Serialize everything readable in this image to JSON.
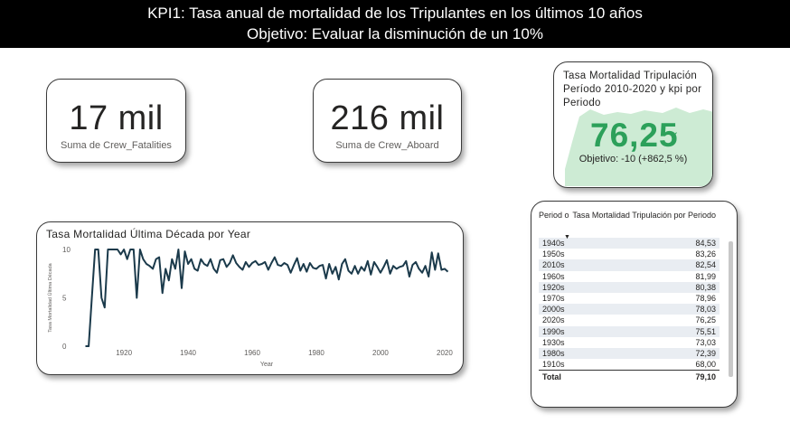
{
  "header": {
    "line1": "KPI1: Tasa anual de mortalidad de los Tripulantes en los últimos 10 años",
    "line2": "Objetivo: Evaluar la disminución de un 10%"
  },
  "card_fatalities": {
    "value": "17 mil",
    "label": "Suma de Crew_Fatalities"
  },
  "card_aboard": {
    "value": "216 mil",
    "label": "Suma de Crew_Aboard"
  },
  "kpi_card": {
    "title": "Tasa Mortalidad Tripulación Período 2010-2020 y kpi por Periodo",
    "value": "76,25",
    "check_icon": "checkmark-icon",
    "goal": "Objetivo: -10 (+862,5 %)",
    "accent": "#2ca05a",
    "area_color": "#cdebd4"
  },
  "table": {
    "col1": "Period o",
    "col2": "Tasa Mortalidad Tripulación por Periodo",
    "rows": [
      {
        "period": "1940s",
        "value": "84,53"
      },
      {
        "period": "1950s",
        "value": "83,26"
      },
      {
        "period": "2010s",
        "value": "82,54"
      },
      {
        "period": "1960s",
        "value": "81,99"
      },
      {
        "period": "1920s",
        "value": "80,38"
      },
      {
        "period": "1970s",
        "value": "78,96"
      },
      {
        "period": "2000s",
        "value": "78,03"
      },
      {
        "period": "2020s",
        "value": "76,25"
      },
      {
        "period": "1990s",
        "value": "75,51"
      },
      {
        "period": "1930s",
        "value": "73,03"
      },
      {
        "period": "1980s",
        "value": "72,39"
      },
      {
        "period": "1910s",
        "value": "68,00"
      }
    ],
    "total_label": "Total",
    "total_value": "79,10"
  },
  "chart_data": {
    "type": "line",
    "title": "Tasa Mortalidad Última Década por Year",
    "xlabel": "Year",
    "ylabel": "Tasa Mortalidad Última Década",
    "xlim": [
      1907,
      2022
    ],
    "ylim": [
      0,
      10
    ],
    "xticks": [
      1920,
      1940,
      1960,
      1980,
      2000,
      2020
    ],
    "yticks": [
      0,
      5,
      10
    ],
    "line_color": "#1b3a4b",
    "x": [
      1908,
      1909,
      1910,
      1911,
      1912,
      1913,
      1914,
      1915,
      1916,
      1917,
      1918,
      1919,
      1920,
      1921,
      1922,
      1923,
      1924,
      1925,
      1926,
      1927,
      1928,
      1929,
      1930,
      1931,
      1932,
      1933,
      1934,
      1935,
      1936,
      1937,
      1938,
      1939,
      1940,
      1941,
      1942,
      1943,
      1944,
      1945,
      1946,
      1947,
      1948,
      1949,
      1950,
      1951,
      1952,
      1953,
      1954,
      1955,
      1956,
      1957,
      1958,
      1959,
      1960,
      1961,
      1962,
      1963,
      1964,
      1965,
      1966,
      1967,
      1968,
      1969,
      1970,
      1971,
      1972,
      1973,
      1974,
      1975,
      1976,
      1977,
      1978,
      1979,
      1980,
      1981,
      1982,
      1983,
      1984,
      1985,
      1986,
      1987,
      1988,
      1989,
      1990,
      1991,
      1992,
      1993,
      1994,
      1995,
      1996,
      1997,
      1998,
      1999,
      2000,
      2001,
      2002,
      2003,
      2004,
      2005,
      2006,
      2007,
      2008,
      2009,
      2010,
      2011,
      2012,
      2013,
      2014,
      2015,
      2016,
      2017,
      2018,
      2019,
      2020,
      2021
    ],
    "y": [
      0,
      0,
      5,
      10,
      10,
      5,
      4,
      10,
      10,
      10,
      10,
      9.5,
      10,
      9,
      10,
      10,
      5,
      10,
      9,
      8.5,
      8.3,
      8,
      9,
      9.2,
      5.5,
      8,
      6.8,
      9,
      8,
      10,
      6,
      9.8,
      8.5,
      9,
      8,
      7.8,
      9,
      8.5,
      8.3,
      9,
      8,
      7.6,
      8.9,
      9,
      8.2,
      8.6,
      9.4,
      8.6,
      8.2,
      7.9,
      8.7,
      8.2,
      8.6,
      8.8,
      8.4,
      8.5,
      8.7,
      7.9,
      8.6,
      9.2,
      8.4,
      8.3,
      8.6,
      8.4,
      7.6,
      8.4,
      9.1,
      7.8,
      8.5,
      7.7,
      8.6,
      8.1,
      8,
      8.3,
      8.4,
      7,
      8.5,
      7.5,
      8.2,
      6.9,
      8.5,
      9,
      7.8,
      7.5,
      8.3,
      7.5,
      8.2,
      7.8,
      8.8,
      7.4,
      8.7,
      8.2,
      7.6,
      8.2,
      8.9,
      7.5,
      8.3,
      8,
      8.2,
      8.3,
      8.8,
      7.2,
      8.4,
      8.7,
      8,
      7.6,
      8.3,
      7.2,
      9.7,
      7.9,
      9.6,
      7.9,
      8,
      7.7,
      8.1,
      7
    ]
  }
}
